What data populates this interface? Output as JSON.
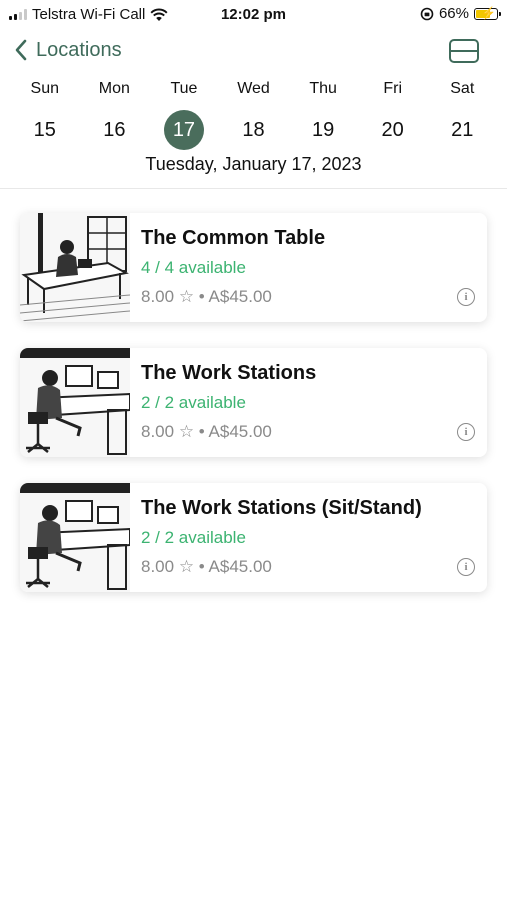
{
  "status_bar": {
    "carrier": "Telstra Wi-Fi Call",
    "time": "12:02 pm",
    "battery": "66%"
  },
  "nav": {
    "back_label": "Locations"
  },
  "calendar": {
    "weekdays": [
      "Sun",
      "Mon",
      "Tue",
      "Wed",
      "Thu",
      "Fri",
      "Sat"
    ],
    "days": [
      "15",
      "16",
      "17",
      "18",
      "19",
      "20",
      "21"
    ],
    "selected": "17",
    "full_date": "Tuesday, January 17, 2023"
  },
  "locations": [
    {
      "title": "The Common Table",
      "availability": "4 / 4 available",
      "rating": "8.00",
      "price": "A$45.00"
    },
    {
      "title": "The Work Stations",
      "availability": "2 / 2 available",
      "rating": "8.00",
      "price": "A$45.00"
    },
    {
      "title": "The Work Stations (Sit/Stand)",
      "availability": "2 / 2 available",
      "rating": "8.00",
      "price": "A$45.00"
    }
  ],
  "colors": {
    "accent": "#4a6d5c",
    "available": "#3cb371",
    "muted": "#8a8a8a"
  }
}
